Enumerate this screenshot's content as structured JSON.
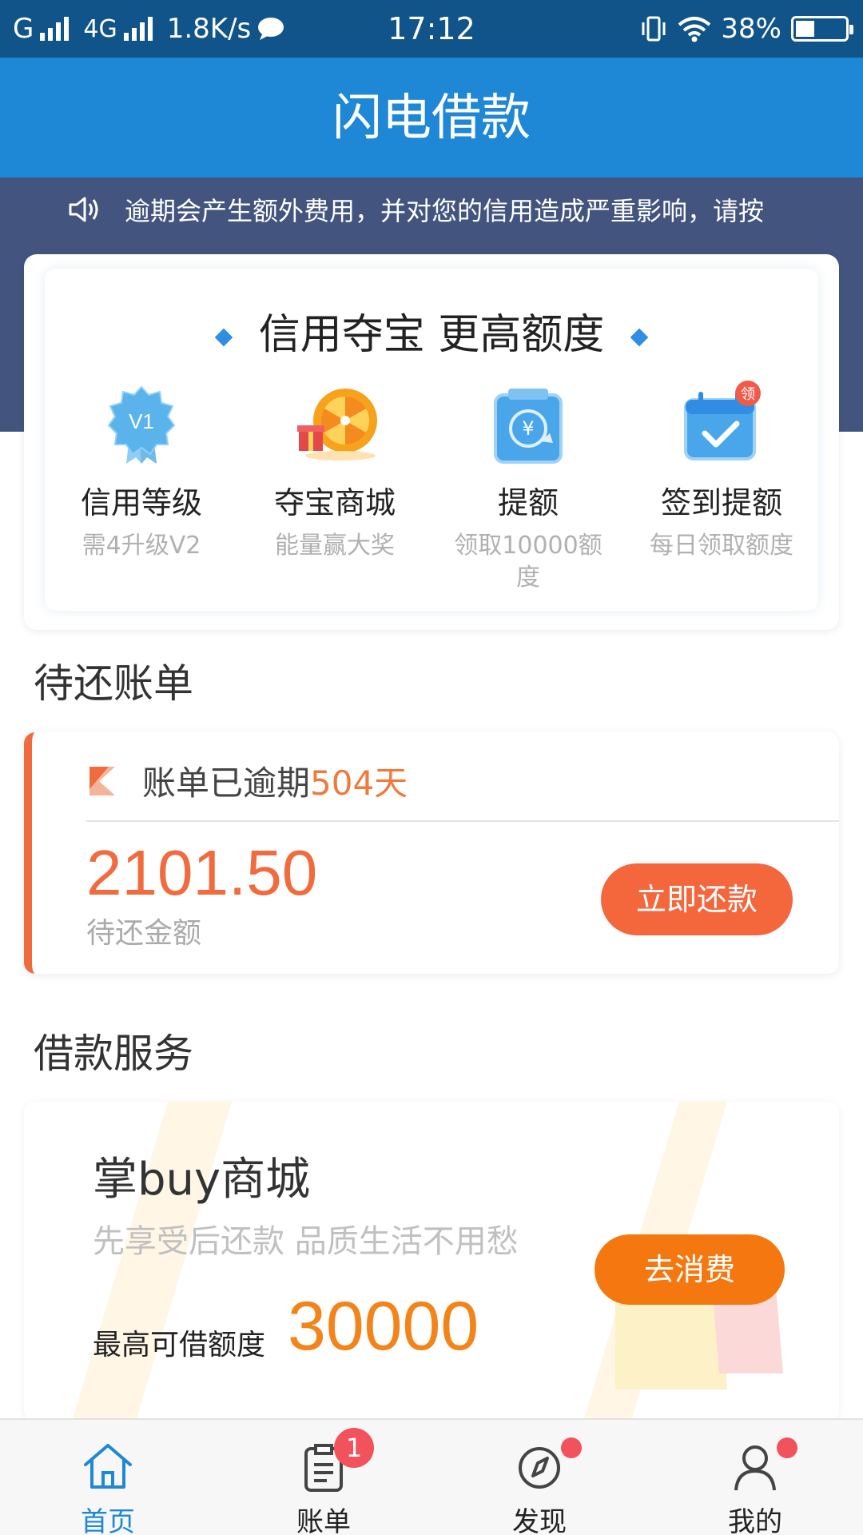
{
  "status_bar": {
    "carrier": "G",
    "network": "4G",
    "speed": "1.8K/s",
    "time": "17:12",
    "battery": "38%",
    "battery_level": 0.38
  },
  "header": {
    "title": "闪电借款"
  },
  "notice": {
    "text": "逾期会产生额外费用，并对您的信用造成严重影响，请按"
  },
  "credit": {
    "title": "信用夺宝 更高额度",
    "items": [
      {
        "icon": "v1-badge-icon",
        "badge_text": "V1",
        "name": "信用等级",
        "desc": "需4升级V2"
      },
      {
        "icon": "prize-wheel-icon",
        "name": "夺宝商城",
        "desc": "能量赢大奖"
      },
      {
        "icon": "raise-limit-icon",
        "name": "提额",
        "desc": "领取10000额度"
      },
      {
        "icon": "calendar-check-icon",
        "badge_text": "领",
        "name": "签到提额",
        "desc": "每日领取额度"
      }
    ]
  },
  "bills": {
    "section_title": "待还账单",
    "status_prefix": "账单已逾期",
    "overdue": "504天",
    "amount": "2101.50",
    "amount_label": "待还金额",
    "pay_button": "立即还款"
  },
  "services": {
    "section_title": "借款服务",
    "card": {
      "title": "掌buy商城",
      "subtitle": "先享受后还款 品质生活不用愁",
      "limit_label": "最高可借额度",
      "limit_value": "30000",
      "button": "去消费"
    }
  },
  "tabbar": {
    "items": [
      {
        "label": "首页",
        "icon": "home-icon",
        "active": true
      },
      {
        "label": "账单",
        "icon": "bill-icon",
        "badge": "1"
      },
      {
        "label": "发现",
        "icon": "compass-icon",
        "dot": true
      },
      {
        "label": "我的",
        "icon": "user-icon",
        "dot": true
      }
    ]
  },
  "colors": {
    "status_bar": "#11548a",
    "header": "#1e88d6",
    "notice_bg": "#43547e",
    "accent_orange": "#f06b3e",
    "service_orange": "#f4780f",
    "badge_red": "#f2525c"
  }
}
